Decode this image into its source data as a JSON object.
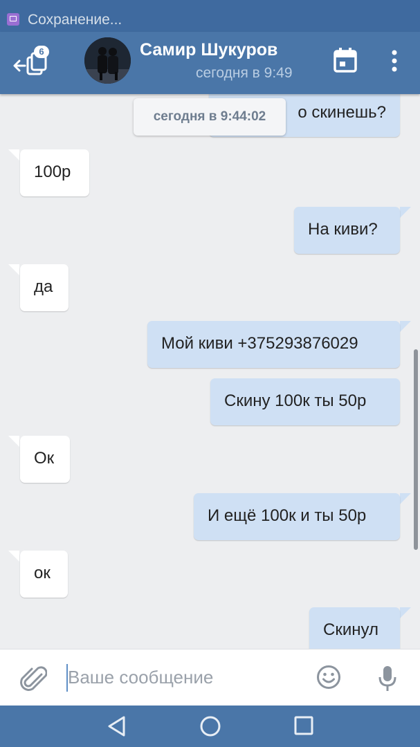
{
  "status_bar": {
    "text": "Сохранение..."
  },
  "header": {
    "badge_count": "6",
    "contact_name": "Самир Шукуров",
    "contact_status": "сегодня в 9:49",
    "back_icon": "back-arrow-icon",
    "calendar_icon": "calendar-icon",
    "more_icon": "more-vertical-icon"
  },
  "chat": {
    "date_pill": "сегодня в 9:44:02",
    "messages": [
      {
        "direction": "out",
        "text": "о скинешь?"
      },
      {
        "direction": "in",
        "text": "100р"
      },
      {
        "direction": "out",
        "text": "На киви?"
      },
      {
        "direction": "in",
        "text": "да"
      },
      {
        "direction": "out",
        "text": "Мой киви +375293876029"
      },
      {
        "direction": "out",
        "text": "Скину 100к ты 50р"
      },
      {
        "direction": "in",
        "text": "Ок"
      },
      {
        "direction": "out",
        "text": "И ещё 100к и ты 50р"
      },
      {
        "direction": "in",
        "text": "ок"
      },
      {
        "direction": "out",
        "text": "Скинул"
      }
    ]
  },
  "composer": {
    "placeholder": "Ваше сообщение",
    "value": "",
    "attach_icon": "paperclip-icon",
    "emoji_icon": "smiley-icon",
    "mic_icon": "microphone-icon"
  },
  "navbar": {
    "back_icon": "nav-back-triangle-icon",
    "home_icon": "nav-home-circle-icon",
    "recents_icon": "nav-recents-square-icon"
  },
  "colors": {
    "header": "#4a76a8",
    "status_bar": "#3f6a9f",
    "outgoing_bubble": "#cfe0f4",
    "incoming_bubble": "#ffffff",
    "chat_background": "#edeef0"
  }
}
